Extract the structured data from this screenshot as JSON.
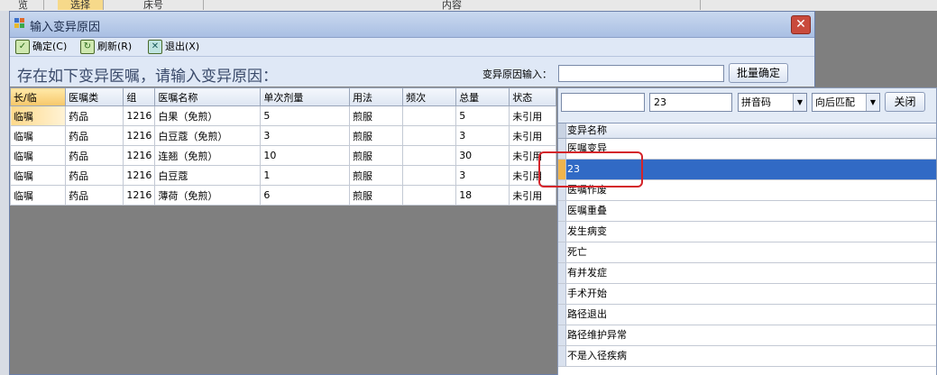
{
  "background": {
    "strip_cells": [
      "览",
      "选择",
      "床号",
      "内容"
    ]
  },
  "dialog": {
    "title": "输入变异原因",
    "close_symbol": "✕",
    "toolbar": [
      {
        "label": "确定(C)",
        "icon": "check-icon"
      },
      {
        "label": "刷新(R)",
        "icon": "refresh-icon"
      },
      {
        "label": "退出(X)",
        "icon": "exit-icon"
      }
    ],
    "prompt": "存在如下变异医嘱，请输入变异原因：",
    "reason_label": "变异原因输入：",
    "reason_value": "",
    "batch_button": "批量确定"
  },
  "grid": {
    "columns": [
      "长/临",
      "医嘱类",
      "组",
      "医嘱名称",
      "单次剂量",
      "用法",
      "频次",
      "总量",
      "状态"
    ],
    "rows": [
      [
        "临嘱",
        "药品",
        "1216",
        "白果（免煎）",
        "5",
        "煎服",
        "",
        "5",
        "未引用"
      ],
      [
        "临嘱",
        "药品",
        "1216",
        "白豆蔻（免煎）",
        "3",
        "煎服",
        "",
        "3",
        "未引用"
      ],
      [
        "临嘱",
        "药品",
        "1216",
        "连翘（免煎）",
        "10",
        "煎服",
        "",
        "30",
        "未引用"
      ],
      [
        "临嘱",
        "药品",
        "1216",
        "白豆蔻",
        "1",
        "煎服",
        "",
        "3",
        "未引用"
      ],
      [
        "临嘱",
        "药品",
        "1216",
        "薄荷（免煎）",
        "6",
        "煎服",
        "",
        "18",
        "未引用"
      ]
    ]
  },
  "popup": {
    "input1": "",
    "input2": "23",
    "combo1": "拼音码",
    "combo2": "向后匹配",
    "close_button": "关闭",
    "list_header": "变异名称",
    "items": [
      "医嘱变异",
      "23",
      "医嘱作废",
      "医嘱重叠",
      "发生病变",
      "死亡",
      "有并发症",
      "手术开始",
      "路径退出",
      "路径维护异常",
      "不是入径疾病"
    ],
    "selected_index": 1
  }
}
